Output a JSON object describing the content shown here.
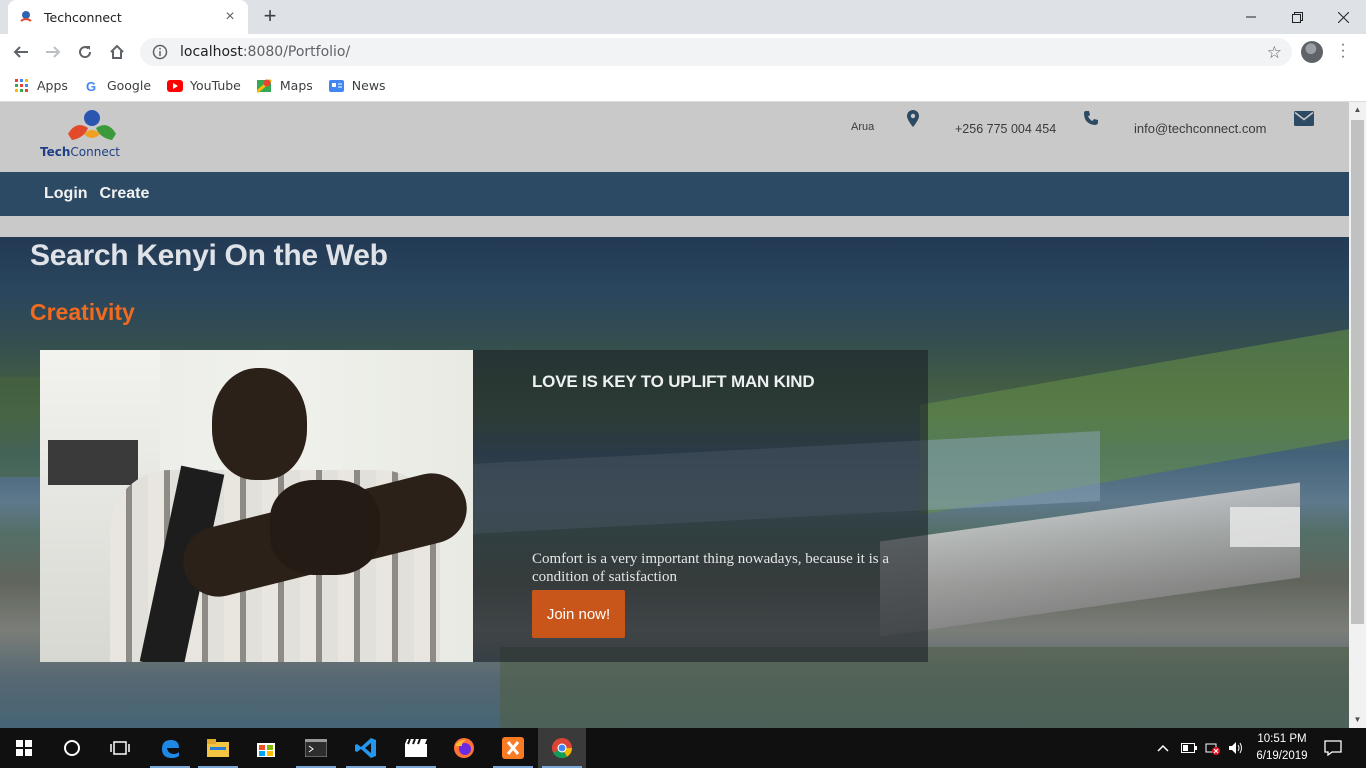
{
  "browser": {
    "tab_title": "Techconnect",
    "tab_close": "×",
    "new_tab": "+",
    "url_host": "localhost",
    "url_rest": ":8080/Portfolio/",
    "bookmarks": [
      {
        "label": "Apps",
        "icon": "apps-grid-icon"
      },
      {
        "label": "Google",
        "icon": "google-icon"
      },
      {
        "label": "YouTube",
        "icon": "youtube-icon"
      },
      {
        "label": "Maps",
        "icon": "maps-icon"
      },
      {
        "label": "News",
        "icon": "news-icon"
      }
    ]
  },
  "site": {
    "logo": {
      "part1": "Tech",
      "part2": "Connect"
    },
    "contact": {
      "location": "Arua",
      "phone": "+256 775 004 454",
      "email": "info@techconnect.com"
    },
    "nav": [
      {
        "label": "Login"
      },
      {
        "label": "Create"
      }
    ],
    "hero": {
      "title": "Search Kenyi On the Web",
      "subtitle": "Creativity",
      "card": {
        "heading": "LOVE IS KEY TO UPLIFT MAN KIND",
        "text": "Comfort is a very important thing nowadays, because it is a condition of satisfaction",
        "button": "Join now!"
      }
    },
    "colors": {
      "header_bg": "#c9c9c9",
      "nav_bg": "#2c4a63",
      "accent_orange": "#f06a1f",
      "button_bg": "#c8561a"
    }
  },
  "taskbar": {
    "time": "10:51 PM",
    "date": "6/19/2019"
  }
}
